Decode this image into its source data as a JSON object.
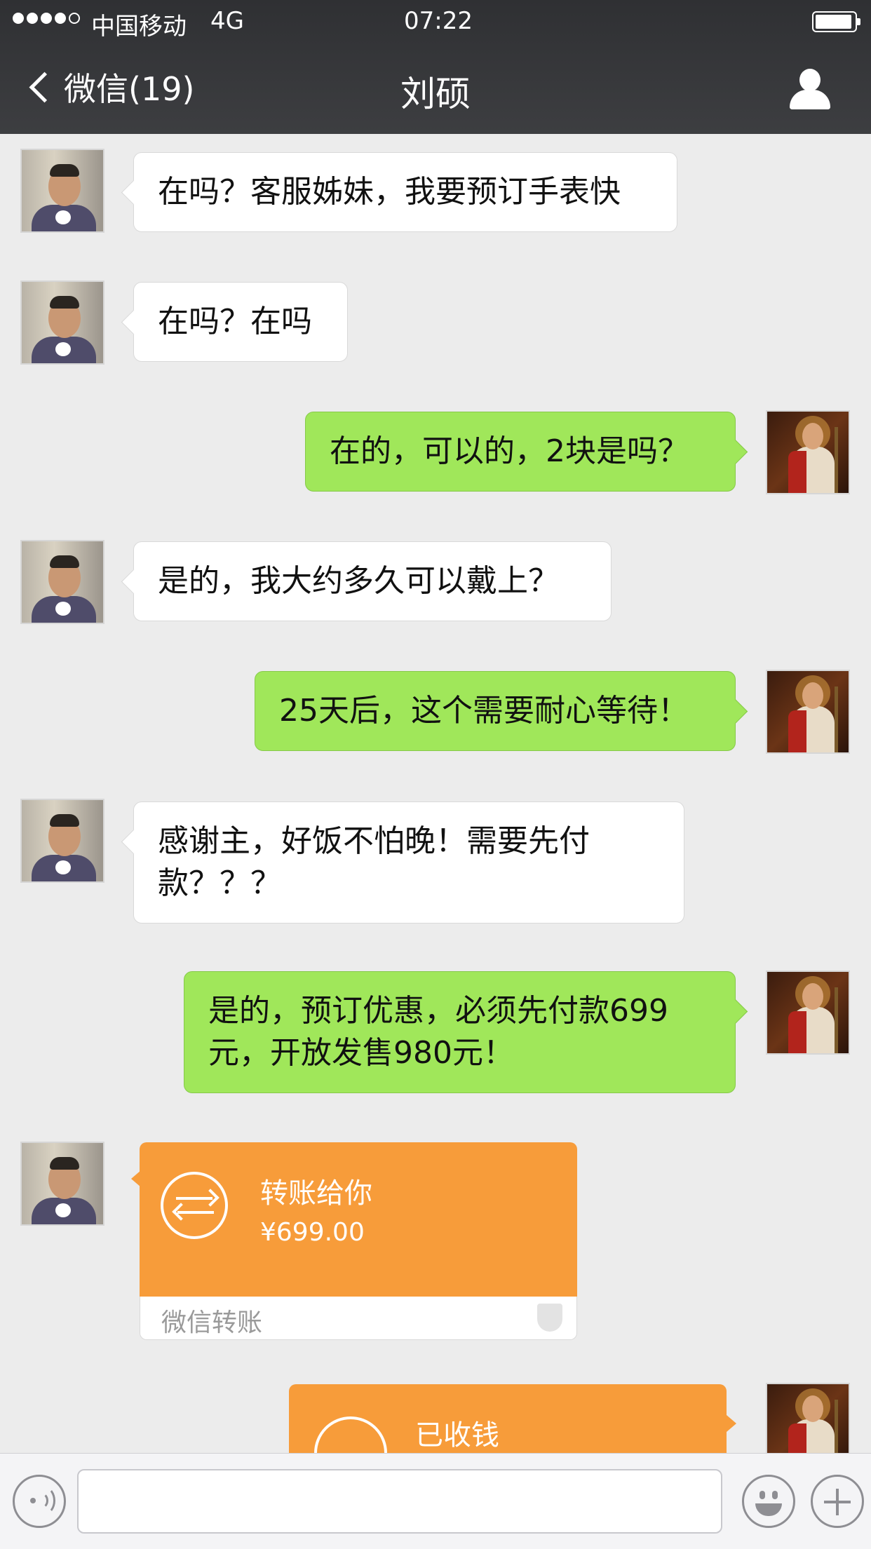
{
  "status": {
    "carrier": "中国移动",
    "network": "4G",
    "time": "07:22"
  },
  "nav": {
    "back_label": "微信(19)",
    "title": "刘硕"
  },
  "messages": [
    {
      "from": "contact",
      "text": "在吗？客服姊妹，我要预订手表快"
    },
    {
      "from": "contact",
      "text": "在吗？在吗"
    },
    {
      "from": "me",
      "text": "在的，可以的，2块是吗？"
    },
    {
      "from": "contact",
      "text": "是的，我大约多久可以戴上？"
    },
    {
      "from": "me",
      "text": "25天后，这个需要耐心等待！"
    },
    {
      "from": "contact",
      "text": "感谢主，好饭不怕晚！需要先付款？？？"
    },
    {
      "from": "me",
      "text": "是的，预订优惠，必须先付款699元，开放发售980元！"
    },
    {
      "from": "contact",
      "type": "transfer",
      "title": "转账给你",
      "amount": "¥699.00",
      "footer": "微信转账"
    },
    {
      "from": "me",
      "type": "transfer",
      "title": "已收钱"
    }
  ],
  "colors": {
    "my_bubble": "#a0e75a",
    "transfer": "#f79c3a",
    "nav_bg": "#2f3033"
  }
}
